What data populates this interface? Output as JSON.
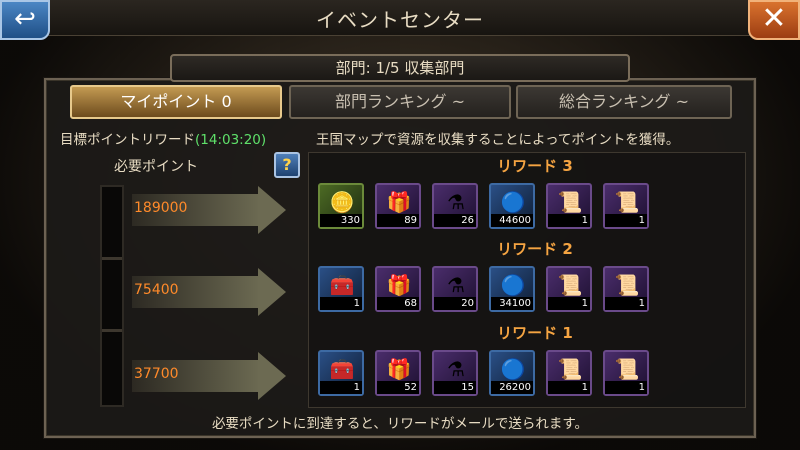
{
  "header": {
    "title": "イベントセンター",
    "back_glyph": "↩",
    "close_glyph": "✕"
  },
  "section": "部門: 1/5 収集部門",
  "tabs": [
    {
      "label": "マイポイント 0",
      "active": true
    },
    {
      "label": "部門ランキング ~",
      "active": false
    },
    {
      "label": "総合ランキング ~",
      "active": false
    }
  ],
  "goal": {
    "title": "目標ポイントリワード",
    "timer": "(14:03:20)",
    "description": "王国マップで資源を収集することによってポイントを獲得。",
    "need_label": "必要ポイント",
    "help": "?"
  },
  "tiers": [
    {
      "points": "189000",
      "reward_label": "リワード 3",
      "items": [
        {
          "name": "gold-coins-icon",
          "glyph": "🪙",
          "qty": "330",
          "style": "green"
        },
        {
          "name": "purple-chest-icon",
          "glyph": "🎁",
          "qty": "89",
          "style": "purple"
        },
        {
          "name": "potion-icon",
          "glyph": "⚗",
          "qty": "26",
          "style": "purple"
        },
        {
          "name": "blue-orb-icon",
          "glyph": "🔵",
          "qty": "44600",
          "style": "blue"
        },
        {
          "name": "scroll-blue-icon",
          "glyph": "📜",
          "qty": "1",
          "style": "purple"
        },
        {
          "name": "scroll-orange-icon",
          "glyph": "📜",
          "qty": "1",
          "style": "purple"
        }
      ]
    },
    {
      "points": "75400",
      "reward_label": "リワード 2",
      "items": [
        {
          "name": "treasure-chest-icon",
          "glyph": "🧰",
          "qty": "1",
          "style": "blue"
        },
        {
          "name": "purple-chest-icon",
          "glyph": "🎁",
          "qty": "68",
          "style": "purple"
        },
        {
          "name": "potion-icon",
          "glyph": "⚗",
          "qty": "20",
          "style": "purple"
        },
        {
          "name": "blue-orb-icon",
          "glyph": "🔵",
          "qty": "34100",
          "style": "blue"
        },
        {
          "name": "scroll-blue-icon",
          "glyph": "📜",
          "qty": "1",
          "style": "purple"
        },
        {
          "name": "scroll-orange-icon",
          "glyph": "📜",
          "qty": "1",
          "style": "purple"
        }
      ]
    },
    {
      "points": "37700",
      "reward_label": "リワード 1",
      "items": [
        {
          "name": "gold-chest-icon",
          "glyph": "🧰",
          "qty": "1",
          "style": "blue"
        },
        {
          "name": "purple-chest-icon",
          "glyph": "🎁",
          "qty": "52",
          "style": "purple"
        },
        {
          "name": "potion-icon",
          "glyph": "⚗",
          "qty": "15",
          "style": "purple"
        },
        {
          "name": "blue-orb-icon",
          "glyph": "🔵",
          "qty": "26200",
          "style": "blue"
        },
        {
          "name": "scroll-blue-icon",
          "glyph": "📜",
          "qty": "1",
          "style": "purple"
        },
        {
          "name": "scroll-orange-icon",
          "glyph": "📜",
          "qty": "1",
          "style": "purple"
        }
      ]
    }
  ],
  "footer": "必要ポイントに到達すると、リワードがメールで送られます。"
}
